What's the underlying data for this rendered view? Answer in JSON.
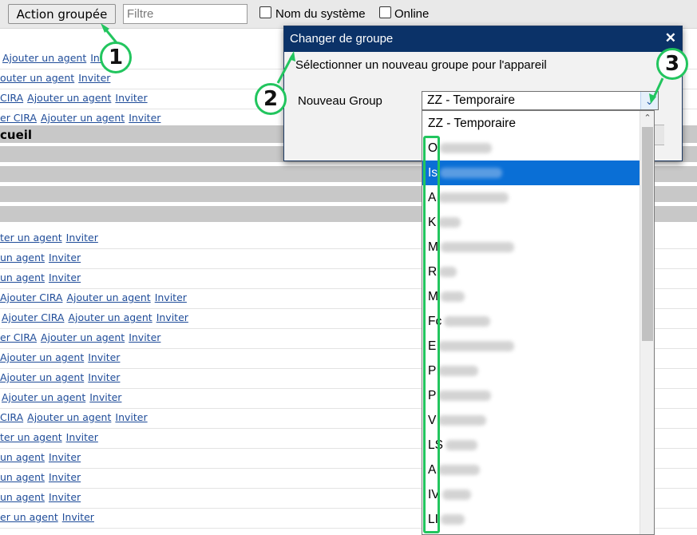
{
  "toolbar": {
    "action_button": "Action groupée",
    "filter_placeholder": "Filtre",
    "checkbox_system_name": "Nom du système",
    "checkbox_online": "Online"
  },
  "background": {
    "section_label": "cueil",
    "rows_top": [
      [
        "Ajouter un agent",
        "Invi"
      ],
      [
        "outer un agent",
        "Inviter"
      ],
      [
        "CIRA",
        "Ajouter un agent",
        "Inviter"
      ],
      [
        "er CIRA",
        "Ajouter un agent",
        "Inviter"
      ]
    ],
    "rows_bottom": [
      [
        "ter un agent",
        "Inviter"
      ],
      [
        "un agent",
        "Inviter"
      ],
      [
        "un agent",
        "Inviter"
      ],
      [
        "Ajouter CIRA",
        "Ajouter un agent",
        "Inviter"
      ],
      [
        "Ajouter CIRA",
        "Ajouter un agent",
        "Inviter"
      ],
      [
        "er CIRA",
        "Ajouter un agent",
        "Inviter"
      ],
      [
        "Ajouter un agent",
        "Inviter"
      ],
      [
        "Ajouter un agent",
        "Inviter"
      ],
      [
        "Ajouter un agent",
        "Inviter"
      ],
      [
        "CIRA",
        "Ajouter un agent",
        "Inviter"
      ],
      [
        "ter un agent",
        "Inviter"
      ],
      [
        "un agent",
        "Inviter"
      ],
      [
        "un agent",
        "Inviter"
      ],
      [
        "un agent",
        "Inviter"
      ],
      [
        "er un agent",
        "Inviter"
      ]
    ]
  },
  "dialog": {
    "title": "Changer de groupe",
    "close_glyph": "✕",
    "message": "Sélectionner un nouveau groupe pour l'appareil",
    "field_label": "Nouveau Group",
    "selected_value": "ZZ - Temporaire"
  },
  "dropdown": {
    "options": [
      {
        "text": "ZZ - Temporaire",
        "selected": false
      },
      {
        "text": "O",
        "selected": false
      },
      {
        "text": "Is",
        "selected": true
      },
      {
        "text": "A",
        "selected": false
      },
      {
        "text": "K",
        "selected": false
      },
      {
        "text": "M",
        "selected": false
      },
      {
        "text": "R",
        "selected": false
      },
      {
        "text": "M",
        "selected": false
      },
      {
        "text": "Fc",
        "selected": false
      },
      {
        "text": "E",
        "selected": false
      },
      {
        "text": "P",
        "selected": false
      },
      {
        "text": "P",
        "selected": false
      },
      {
        "text": "V",
        "selected": false
      },
      {
        "text": "LS",
        "selected": false
      },
      {
        "text": "A",
        "selected": false
      },
      {
        "text": "IV",
        "selected": false
      },
      {
        "text": "LI",
        "selected": false
      }
    ],
    "scroll_up_glyph": "⌃"
  },
  "annotations": {
    "marker_1": "1",
    "marker_2": "2",
    "marker_3": "3"
  },
  "colors": {
    "dialog_title_bar": "#0b3268",
    "selected_option": "#0a6fd6",
    "link": "#1f4c99",
    "annotation": "#22c55e"
  }
}
